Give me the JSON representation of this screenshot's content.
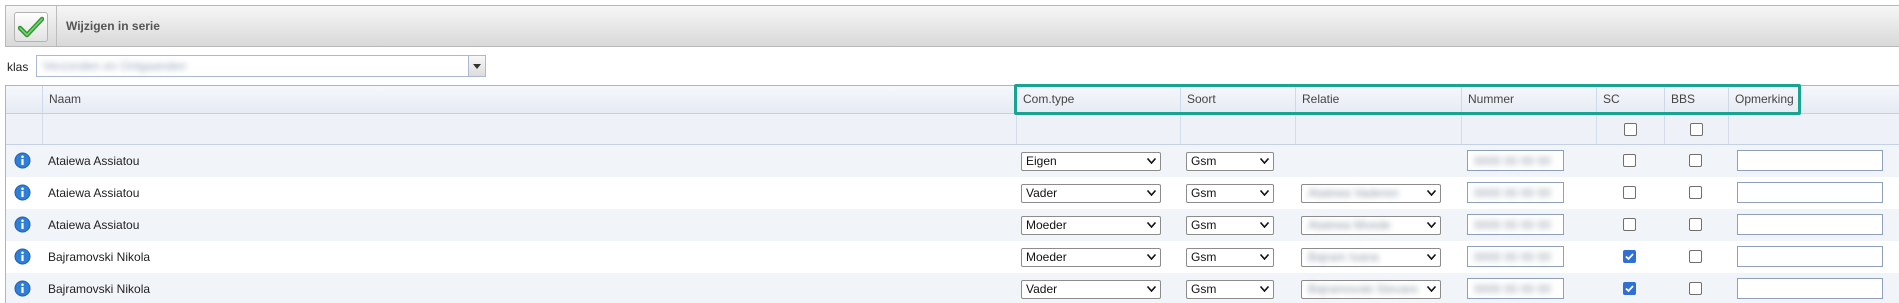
{
  "toolbar": {
    "title": "Wijzigen in serie",
    "save_icon": "checkmark-icon"
  },
  "klas": {
    "label": "klas",
    "value": "Verzonden en Ontgaanden"
  },
  "grid": {
    "columns": {
      "naam": "Naam",
      "comtype": "Com.type",
      "soort": "Soort",
      "relatie": "Relatie",
      "nummer": "Nummer",
      "sc": "SC",
      "bbs": "BBS",
      "opmerking": "Opmerking"
    },
    "filter": {
      "sc_checked": false,
      "bbs_checked": false
    },
    "rows": [
      {
        "naam": "Ataiewa Assiatou",
        "comtype": "Eigen",
        "soort": "Gsm",
        "relatie": "",
        "nummer": "0000 00 00 00",
        "sc": false,
        "bbs": false,
        "opmerking": ""
      },
      {
        "naam": "Ataiewa Assiatou",
        "comtype": "Vader",
        "soort": "Gsm",
        "relatie": "Ataiewa Vaderen",
        "nummer": "0000 00 00 00",
        "sc": false,
        "bbs": false,
        "opmerking": ""
      },
      {
        "naam": "Ataiewa Assiatou",
        "comtype": "Moeder",
        "soort": "Gsm",
        "relatie": "Ataiewa Moede",
        "nummer": "0000 00 00 00",
        "sc": false,
        "bbs": false,
        "opmerking": ""
      },
      {
        "naam": "Bajramovski Nikola",
        "comtype": "Moeder",
        "soort": "Gsm",
        "relatie": "Bajram Ivana",
        "nummer": "0000 00 00 00",
        "sc": true,
        "bbs": false,
        "opmerking": ""
      },
      {
        "naam": "Bajramovski Nikola",
        "comtype": "Vader",
        "soort": "Gsm",
        "relatie": "Bajramovski Stevandelje",
        "nummer": "0000 00 00 00",
        "sc": true,
        "bbs": false,
        "opmerking": ""
      }
    ]
  },
  "colors": {
    "highlight": "#1aa390",
    "checkbox_on": "#2f6fd6",
    "info_icon": "#2f7fd8"
  }
}
